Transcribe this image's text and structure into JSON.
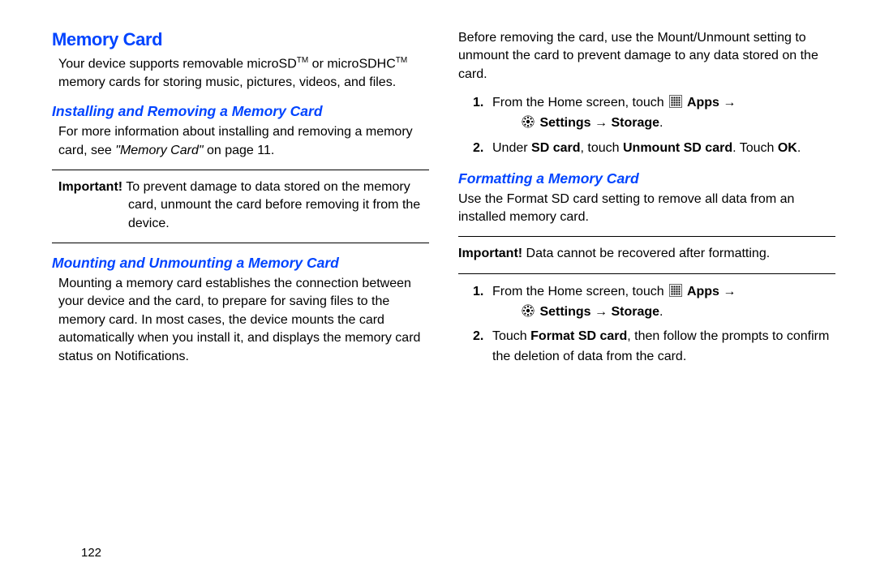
{
  "pageNumber": "122",
  "left": {
    "title": "Memory Card",
    "intro_1": "Your device supports removable microSD",
    "intro_2": " or microSDHC",
    "intro_3": " memory cards for storing music, pictures, videos, and files.",
    "tm": "TM",
    "sub1": "Installing and Removing a Memory Card",
    "sub1_p_a": "For more information about installing and removing a memory card, see ",
    "sub1_p_ref": "\"Memory Card\"",
    "sub1_p_b": " on page 11.",
    "imp_label": "Important!",
    "imp1": " To prevent damage to data stored on the memory card, unmount the card before removing it from the device.",
    "sub2": "Mounting and Unmounting a Memory Card",
    "sub2_p": "Mounting a memory card establishes the connection between your device and the card, to prepare for saving files to the memory card. In most cases, the device mounts the card automatically when you install it, and displays the memory card status on Notifications."
  },
  "right": {
    "intro": "Before removing the card, use the Mount/Unmount setting to unmount the card to prevent damage to any data stored on the card.",
    "step1_a": "From the Home screen, touch ",
    "apps": " Apps ",
    "arrow": "→",
    "settings": " Settings ",
    "storage": " Storage",
    "step2_a": "Under ",
    "sdcard": "SD card",
    "step2_b": ", touch ",
    "unmount": "Unmount SD card",
    "step2_c": ". Touch ",
    "ok": "OK",
    "step2_d": ".",
    "sub3": "Formatting a Memory Card",
    "sub3_p": "Use the Format SD card setting to remove all data from an installed memory card.",
    "imp_label": "Important!",
    "imp2": " Data cannot be recovered after formatting.",
    "fstep2_a": "Touch ",
    "format": "Format SD card",
    "fstep2_b": ", then follow the prompts to confirm the deletion of data from the card."
  }
}
